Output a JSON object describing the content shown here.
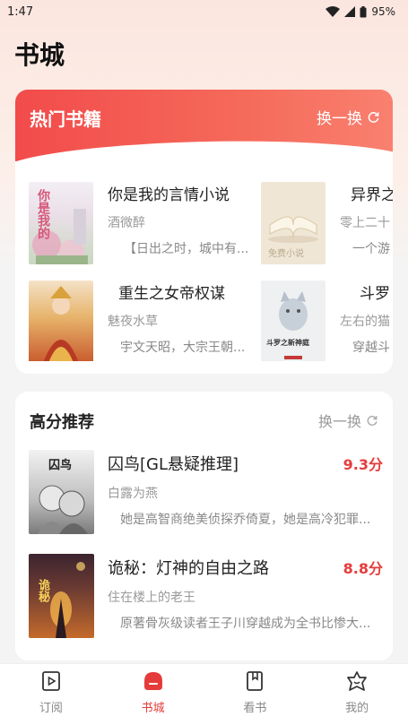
{
  "status_bar": {
    "time": "1:47",
    "battery": "95%"
  },
  "page_title": "书城",
  "hot_books": {
    "title": "热门书籍",
    "refresh_label": "换一换",
    "items": [
      {
        "title": "你是我的言情小说",
        "author": "酒微醉",
        "desc": "【日出之时，城中有..."
      },
      {
        "title": "异界之",
        "author": "零上二十",
        "desc": "一个游"
      },
      {
        "title": "重生之女帝权谋",
        "author": "魅夜水草",
        "desc": "宇文天昭，大宗王朝..."
      },
      {
        "title": "斗罗",
        "author": "左右的猫",
        "desc": "穿越斗"
      }
    ],
    "cover_texts": [
      "你是我的",
      "免费小说",
      "斗罗之新神庭"
    ]
  },
  "high_score": {
    "title": "高分推荐",
    "refresh_label": "换一换",
    "items": [
      {
        "title": "囚鸟[GL悬疑推理]",
        "author": "白露为燕",
        "desc": "她是高智商绝美侦探乔倚夏，她是高冷犯罪...",
        "score": "9.3分"
      },
      {
        "title": "诡秘：灯神的自由之路",
        "author": "住在楼上的老王",
        "desc": "原著骨灰级读者王子川穿越成为全书比惨大...",
        "score": "8.8分"
      }
    ],
    "cover_texts": [
      "囚鸟",
      "诡秘"
    ]
  },
  "nav": [
    {
      "label": "订阅",
      "icon": "subscribe-icon",
      "active": false
    },
    {
      "label": "书城",
      "icon": "bookstore-icon",
      "active": true
    },
    {
      "label": "看书",
      "icon": "read-icon",
      "active": false
    },
    {
      "label": "我的",
      "icon": "profile-icon",
      "active": false
    }
  ],
  "colors": {
    "accent": "#e63b3b",
    "header_gradient_start": "#f24b4b",
    "header_gradient_end": "#f9806f"
  }
}
